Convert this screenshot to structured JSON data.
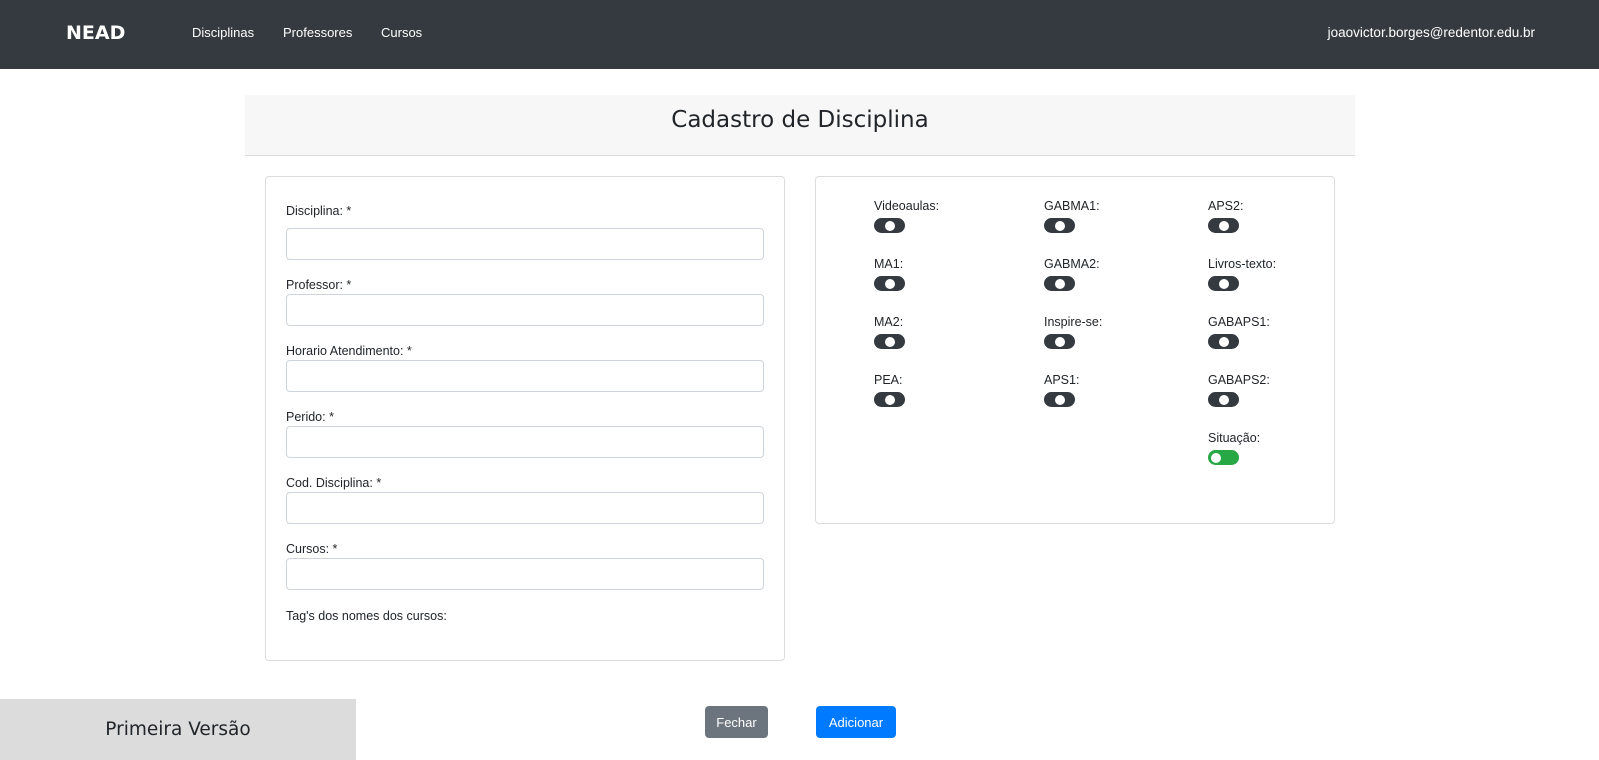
{
  "navbar": {
    "brand": "NEAD",
    "links": [
      "Disciplinas",
      "Professores",
      "Cursos"
    ],
    "user_email": "joaovictor.borges@redentor.edu.br"
  },
  "page": {
    "title": "Cadastro de Disciplina"
  },
  "form": {
    "fields": [
      {
        "label": "Disciplina: *",
        "value": ""
      },
      {
        "label": "Professor: *",
        "value": ""
      },
      {
        "label": "Horario Atendimento: *",
        "value": ""
      },
      {
        "label": "Perido: *",
        "value": ""
      },
      {
        "label": "Cod. Disciplina: *",
        "value": ""
      },
      {
        "label": "Cursos: *",
        "value": ""
      }
    ],
    "tags_label": "Tag's dos nomes dos cursos:"
  },
  "toggles": [
    {
      "label": "Videoaulas:",
      "on": false
    },
    {
      "label": "GABMA1:",
      "on": false
    },
    {
      "label": "APS2:",
      "on": false
    },
    {
      "label": "MA1:",
      "on": false
    },
    {
      "label": "GABMA2:",
      "on": false
    },
    {
      "label": "Livros-texto:",
      "on": false
    },
    {
      "label": "MA2:",
      "on": false
    },
    {
      "label": "Inspire-se:",
      "on": false
    },
    {
      "label": "GABAPS1:",
      "on": false
    },
    {
      "label": "PEA:",
      "on": false
    },
    {
      "label": "APS1:",
      "on": false
    },
    {
      "label": "GABAPS2:",
      "on": false
    },
    {
      "label": "Situação:",
      "on": true
    }
  ],
  "buttons": {
    "close_label": "Fechar",
    "add_label": "Adicionar"
  },
  "footer": {
    "version_label": "Primeira Versão"
  },
  "colors": {
    "navbar_bg": "#343a40",
    "toggle_off": "#343a40",
    "toggle_on": "#28a745",
    "primary": "#007bff",
    "secondary": "#6c757d"
  }
}
